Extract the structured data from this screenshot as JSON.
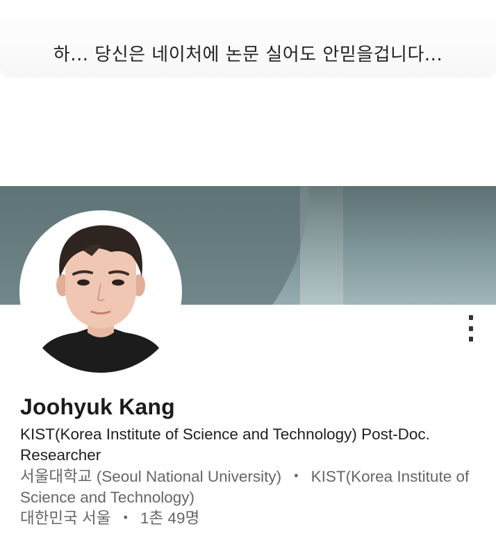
{
  "caption": {
    "text": "하... 당신은 네이처에 논문 실어도 안믿을겁니다..."
  },
  "profile": {
    "name": "Joohyuk Kang",
    "headline": "KIST(Korea Institute of Science and Technology) Post-Doc. Researcher",
    "education": {
      "school": "서울대학교 (Seoul National University)",
      "separator": "・",
      "company": "KIST(Korea Institute of Science and Technology)"
    },
    "location": {
      "place": "대한민국 서울",
      "separator": "・",
      "connections": "1촌 49명"
    },
    "more_icon": "more-vertical-icon"
  },
  "colors": {
    "cover_dark": "#56686a",
    "cover_light": "#96adb1",
    "name_text": "#1b1b1b",
    "secondary_text": "#666666"
  }
}
